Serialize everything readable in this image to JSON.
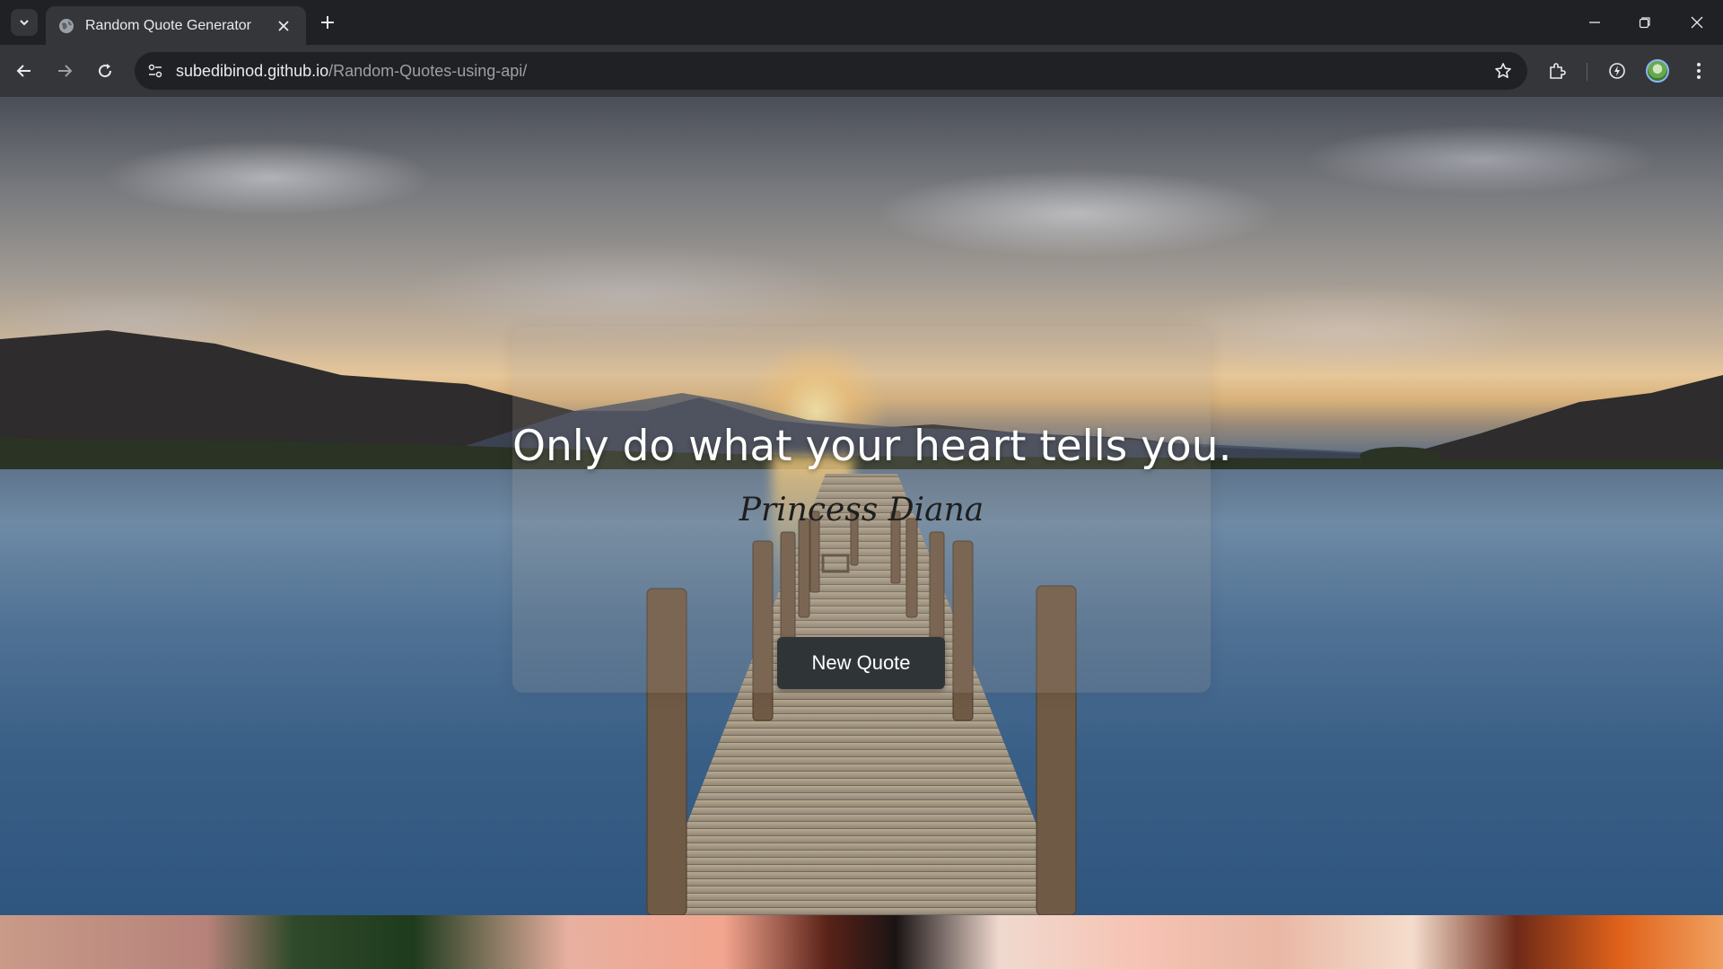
{
  "browser": {
    "tab_title": "Random Quote Generator",
    "url_host": "subedibinod.github.io",
    "url_path": "/Random-Quotes-using-api/"
  },
  "page": {
    "quote": "Only do what your heart tells you.",
    "author": "Princess Diana",
    "button_label": "New Quote"
  },
  "colors": {
    "button_bg": "#2f3437",
    "quote_text": "#ffffff",
    "author_text": "#1e1e1e"
  },
  "icons": [
    "tab-search-icon",
    "globe-icon",
    "close-icon",
    "plus-icon",
    "minimize-icon",
    "restore-icon",
    "window-close-icon",
    "back-arrow-icon",
    "forward-arrow-icon",
    "reload-icon",
    "site-info-icon",
    "star-icon",
    "extensions-icon",
    "performance-icon",
    "profile-avatar",
    "kebab-menu-icon"
  ]
}
